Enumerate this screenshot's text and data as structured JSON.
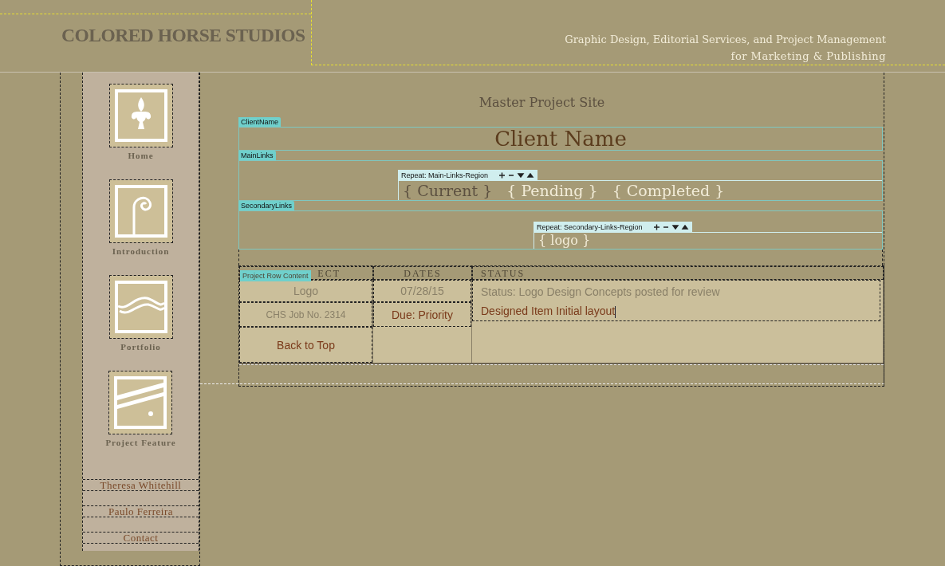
{
  "header": {
    "logo": "COLORED HORSE STUDIOS",
    "tagline_1": "Graphic Design, Editorial Services, and Project Management",
    "tagline_2": "for Marketing & Publishing"
  },
  "sidebar": {
    "nav": [
      {
        "label": "Home",
        "kind": "fleur"
      },
      {
        "label": "Introduction",
        "kind": "spiral"
      },
      {
        "label": "Portfolio",
        "kind": "wave"
      },
      {
        "label": "Project Feature",
        "kind": "slash"
      }
    ],
    "links": [
      "Theresa Whitehill",
      "Paulo Ferreira",
      "Contact"
    ]
  },
  "main": {
    "title": "Master Project Site",
    "client_region": {
      "tag": "ClientName",
      "text": "Client Name"
    },
    "main_links_region": {
      "tag": "MainLinks",
      "repeat_tag": "Repeat: Main-Links-Region",
      "links": [
        {
          "open": "{",
          "label": "Current",
          "close": "}",
          "selected": true
        },
        {
          "open": "{",
          "label": "Pending",
          "close": "}",
          "selected": false
        },
        {
          "open": "{",
          "label": "Completed",
          "close": "}",
          "selected": false
        }
      ]
    },
    "secondary_links_region": {
      "tag": "SecondaryLinks",
      "repeat_tag": "Repeat: Secondary-Links-Region",
      "links": [
        {
          "open": "{",
          "label": "logo",
          "close": "}",
          "selected": false
        }
      ]
    },
    "table": {
      "row_tag": "Project Row Content",
      "columns": [
        "ECT",
        "DATES",
        "STATUS"
      ],
      "project": [
        "Logo",
        "CHS Job No. 2314",
        "Back to Top"
      ],
      "dates": [
        "07/28/15",
        "Due: Priority"
      ],
      "status": "Status: Logo Design Concepts posted for review",
      "note": "Designed Item Initial layout"
    }
  }
}
